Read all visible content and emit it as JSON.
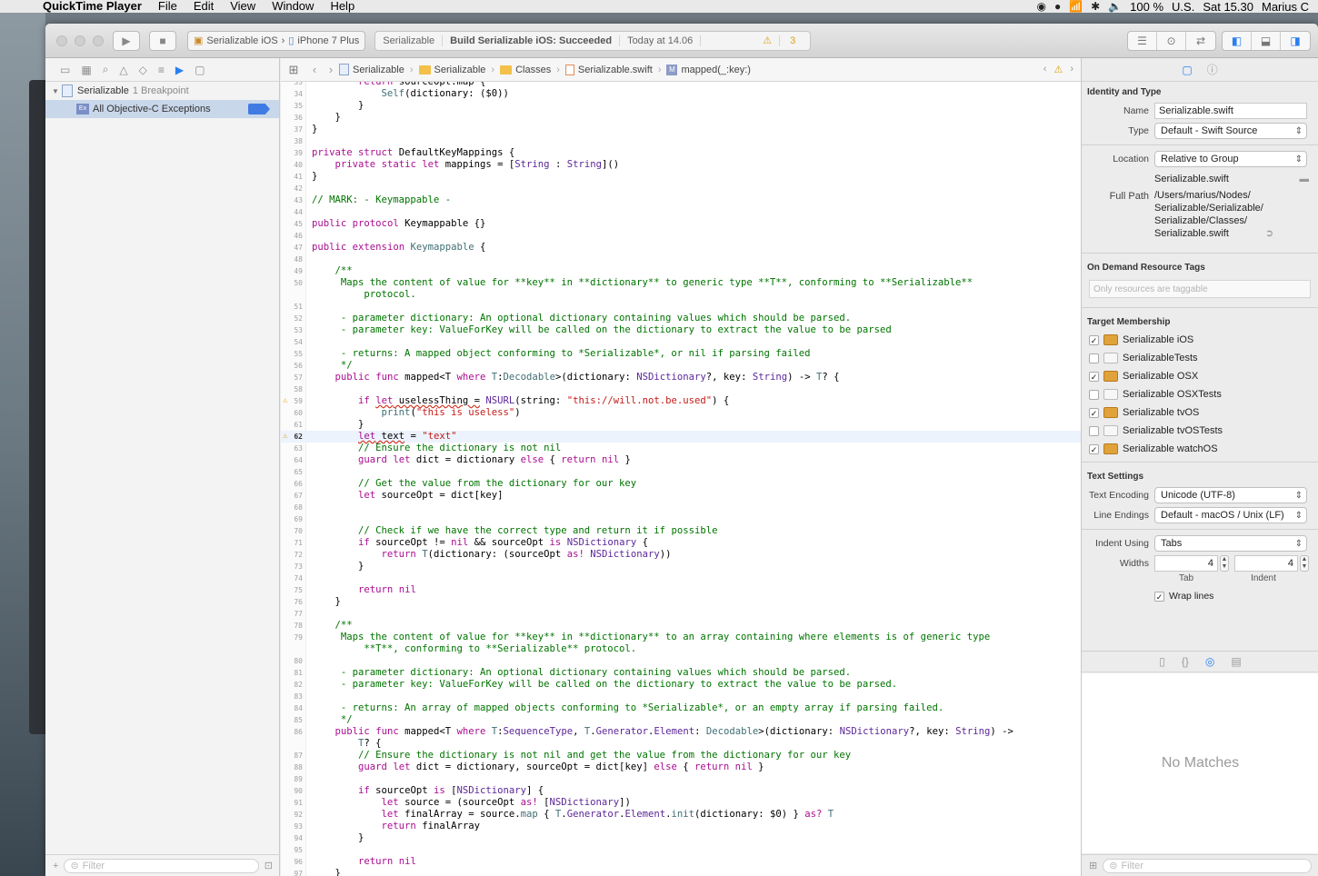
{
  "menubar": {
    "app": "QuickTime Player",
    "items": [
      "File",
      "Edit",
      "View",
      "Window",
      "Help"
    ],
    "battery": "100 %",
    "input_source": "U.S.",
    "clock": "Sat 15.30",
    "user": "Marius C"
  },
  "toolbar": {
    "scheme": "Serializable iOS",
    "device": "iPhone 7 Plus",
    "activity_project": "Serializable",
    "activity_status": "Build Serializable iOS: Succeeded",
    "activity_time": "Today at 14.06",
    "warning_count": "3"
  },
  "navigator": {
    "project": "Serializable",
    "project_sub": "1 Breakpoint",
    "breakpoint": "All Objective-C Exceptions",
    "breakpoint_icon": "Ex",
    "filter_placeholder": "Filter"
  },
  "jumpbar": [
    "Serializable",
    "Serializable",
    "Classes",
    "Serializable.swift",
    "mapped(_:key:)"
  ],
  "jumpbar_method_icon": "M",
  "code": {
    "current_line": 62,
    "warning_lines": [
      59,
      62
    ],
    "lines": [
      {
        "n": "33",
        "h": "        <span class=\"k\">return</span> sourceOpt.map {"
      },
      {
        "n": "34",
        "h": "            <span class=\"f\">Self</span>(dictionary: ($0))"
      },
      {
        "n": "35",
        "h": "        }"
      },
      {
        "n": "36",
        "h": "    }"
      },
      {
        "n": "37",
        "h": "}"
      },
      {
        "n": "38",
        "h": ""
      },
      {
        "n": "39",
        "h": "<span class=\"k\">private</span> <span class=\"k\">struct</span> DefaultKeyMappings {"
      },
      {
        "n": "40",
        "h": "    <span class=\"k\">private</span> <span class=\"k\">static</span> <span class=\"k\">let</span> mappings = [<span class=\"t\">String</span> : <span class=\"t\">String</span>]()"
      },
      {
        "n": "41",
        "h": "}"
      },
      {
        "n": "42",
        "h": ""
      },
      {
        "n": "43",
        "h": "<span class=\"c\">// MARK: - Keymappable -</span>"
      },
      {
        "n": "44",
        "h": ""
      },
      {
        "n": "45",
        "h": "<span class=\"k\">public</span> <span class=\"k\">protocol</span> Keymappable {}"
      },
      {
        "n": "46",
        "h": ""
      },
      {
        "n": "47",
        "h": "<span class=\"k\">public</span> <span class=\"k\">extension</span> <span class=\"f\">Keymappable</span> {"
      },
      {
        "n": "48",
        "h": ""
      },
      {
        "n": "49",
        "h": "    <span class=\"c\">/**</span>"
      },
      {
        "n": "50",
        "h": "<span class=\"c\">     Maps the content of value for **key** in **dictionary** to generic type **T**, conforming to **Serializable**</span>"
      },
      {
        "n": "",
        "h": "<span class=\"c\">         protocol.</span>"
      },
      {
        "n": "51",
        "h": ""
      },
      {
        "n": "52",
        "h": "<span class=\"c\">     - parameter dictionary: An optional dictionary containing values which should be parsed.</span>"
      },
      {
        "n": "53",
        "h": "<span class=\"c\">     - parameter key: ValueForKey will be called on the dictionary to extract the value to be parsed</span>"
      },
      {
        "n": "54",
        "h": ""
      },
      {
        "n": "55",
        "h": "<span class=\"c\">     - returns: A mapped object conforming to *Serializable*, or nil if parsing failed</span>"
      },
      {
        "n": "56",
        "h": "<span class=\"c\">     */</span>"
      },
      {
        "n": "57",
        "h": "    <span class=\"k\">public</span> <span class=\"k\">func</span> mapped&lt;T <span class=\"k\">where</span> <span class=\"f\">T</span>:<span class=\"f\">Decodable</span>&gt;(dictionary: <span class=\"t\">NSDictionary</span>?, key: <span class=\"t\">String</span>) -&gt; <span class=\"f\">T</span>? {"
      },
      {
        "n": "58",
        "h": ""
      },
      {
        "n": "59",
        "h": "        <span class=\"k\">if</span> <span class=\"u\"><span class=\"k\">let</span> uselessThing =</span> <span class=\"t\">NSURL</span>(string: <span class=\"s\">\"this://will.not.be.used\"</span>) {"
      },
      {
        "n": "60",
        "h": "            <span class=\"f\">print</span>(<span class=\"s\">\"this is useless\"</span>)"
      },
      {
        "n": "61",
        "h": "        }"
      },
      {
        "n": "62",
        "h": "        <span class=\"u\"><span class=\"k\">let</span> text</span> = <span class=\"s\">\"text\"</span>"
      },
      {
        "n": "63",
        "h": "        <span class=\"c\">// Ensure the dictionary is not nil</span>"
      },
      {
        "n": "64",
        "h": "        <span class=\"k\">guard</span> <span class=\"k\">let</span> dict = dictionary <span class=\"k\">else</span> { <span class=\"k\">return</span> <span class=\"k\">nil</span> }"
      },
      {
        "n": "65",
        "h": ""
      },
      {
        "n": "66",
        "h": "        <span class=\"c\">// Get the value from the dictionary for our key</span>"
      },
      {
        "n": "67",
        "h": "        <span class=\"k\">let</span> sourceOpt = dict[key]"
      },
      {
        "n": "68",
        "h": ""
      },
      {
        "n": "69",
        "h": ""
      },
      {
        "n": "70",
        "h": "        <span class=\"c\">// Check if we have the correct type and return it if possible</span>"
      },
      {
        "n": "71",
        "h": "        <span class=\"k\">if</span> sourceOpt != <span class=\"k\">nil</span> &amp;&amp; sourceOpt <span class=\"k\">is</span> <span class=\"t\">NSDictionary</span> {"
      },
      {
        "n": "72",
        "h": "            <span class=\"k\">return</span> <span class=\"f\">T</span>(dictionary: (sourceOpt <span class=\"k\">as!</span> <span class=\"t\">NSDictionary</span>))"
      },
      {
        "n": "73",
        "h": "        }"
      },
      {
        "n": "74",
        "h": ""
      },
      {
        "n": "75",
        "h": "        <span class=\"k\">return</span> <span class=\"k\">nil</span>"
      },
      {
        "n": "76",
        "h": "    }"
      },
      {
        "n": "77",
        "h": ""
      },
      {
        "n": "78",
        "h": "    <span class=\"c\">/**</span>"
      },
      {
        "n": "79",
        "h": "<span class=\"c\">     Maps the content of value for **key** in **dictionary** to an array containing where elements is of generic type</span>"
      },
      {
        "n": "",
        "h": "<span class=\"c\">         **T**, conforming to **Serializable** protocol.</span>"
      },
      {
        "n": "80",
        "h": ""
      },
      {
        "n": "81",
        "h": "<span class=\"c\">     - parameter dictionary: An optional dictionary containing values which should be parsed.</span>"
      },
      {
        "n": "82",
        "h": "<span class=\"c\">     - parameter key: ValueForKey will be called on the dictionary to extract the value to be parsed.</span>"
      },
      {
        "n": "83",
        "h": ""
      },
      {
        "n": "84",
        "h": "<span class=\"c\">     - returns: An array of mapped objects conforming to *Serializable*, or an empty array if parsing failed.</span>"
      },
      {
        "n": "85",
        "h": "<span class=\"c\">     */</span>"
      },
      {
        "n": "86",
        "h": "    <span class=\"k\">public</span> <span class=\"k\">func</span> mapped&lt;T <span class=\"k\">where</span> <span class=\"f\">T</span>:<span class=\"t\">SequenceType</span>, <span class=\"f\">T</span>.<span class=\"t\">Generator</span>.<span class=\"t\">Element</span>: <span class=\"f\">Decodable</span>&gt;(dictionary: <span class=\"t\">NSDictionary</span>?, key: <span class=\"t\">String</span>) -&gt;"
      },
      {
        "n": "",
        "h": "        <span class=\"f\">T</span>? {"
      },
      {
        "n": "87",
        "h": "        <span class=\"c\">// Ensure the dictionary is not nil and get the value from the dictionary for our key</span>"
      },
      {
        "n": "88",
        "h": "        <span class=\"k\">guard</span> <span class=\"k\">let</span> dict = dictionary, sourceOpt = dict[key] <span class=\"k\">else</span> { <span class=\"k\">return</span> <span class=\"k\">nil</span> }"
      },
      {
        "n": "89",
        "h": ""
      },
      {
        "n": "90",
        "h": "        <span class=\"k\">if</span> sourceOpt <span class=\"k\">is</span> [<span class=\"t\">NSDictionary</span>] {"
      },
      {
        "n": "91",
        "h": "            <span class=\"k\">let</span> source = (sourceOpt <span class=\"k\">as!</span> [<span class=\"t\">NSDictionary</span>])"
      },
      {
        "n": "92",
        "h": "            <span class=\"k\">let</span> finalArray = source.<span class=\"f\">map</span> { <span class=\"f\">T</span>.<span class=\"t\">Generator</span>.<span class=\"t\">Element</span>.<span class=\"f\">init</span>(dictionary: $0) } <span class=\"k\">as?</span> <span class=\"f\">T</span>"
      },
      {
        "n": "93",
        "h": "            <span class=\"k\">return</span> finalArray"
      },
      {
        "n": "94",
        "h": "        }"
      },
      {
        "n": "95",
        "h": ""
      },
      {
        "n": "96",
        "h": "        <span class=\"k\">return</span> <span class=\"k\">nil</span>"
      },
      {
        "n": "97",
        "h": "    }"
      }
    ]
  },
  "inspector": {
    "identity_title": "Identity and Type",
    "name_label": "Name",
    "name_value": "Serializable.swift",
    "type_label": "Type",
    "type_value": "Default - Swift Source",
    "location_label": "Location",
    "location_value": "Relative to Group",
    "location_file": "Serializable.swift",
    "fullpath_label": "Full Path",
    "fullpath_lines": [
      "/Users/marius/Nodes/",
      "Serializable/Serializable/",
      "Serializable/Classes/",
      "Serializable.swift"
    ],
    "odr_title": "On Demand Resource Tags",
    "odr_placeholder": "Only resources are taggable",
    "target_title": "Target Membership",
    "targets": [
      {
        "name": "Serializable iOS",
        "checked": true,
        "kind": "app"
      },
      {
        "name": "SerializableTests",
        "checked": false,
        "kind": "test"
      },
      {
        "name": "Serializable OSX",
        "checked": true,
        "kind": "app"
      },
      {
        "name": "Serializable OSXTests",
        "checked": false,
        "kind": "test"
      },
      {
        "name": "Serializable tvOS",
        "checked": true,
        "kind": "app"
      },
      {
        "name": "Serializable tvOSTests",
        "checked": false,
        "kind": "test"
      },
      {
        "name": "Serializable watchOS",
        "checked": true,
        "kind": "app"
      }
    ],
    "text_title": "Text Settings",
    "encoding_label": "Text Encoding",
    "encoding_value": "Unicode (UTF-8)",
    "endings_label": "Line Endings",
    "endings_value": "Default - macOS / Unix (LF)",
    "indent_label": "Indent Using",
    "indent_value": "Tabs",
    "widths_label": "Widths",
    "tab_value": "4",
    "indent_width_value": "4",
    "tab_label": "Tab",
    "indent_sub_label": "Indent",
    "wrap_label": "Wrap lines",
    "no_matches": "No Matches",
    "filter_placeholder": "Filter"
  },
  "colors": {
    "accent": "#2a7ff0",
    "warning": "#e0a10e",
    "keyword": "#aa0d91",
    "string": "#c41a16",
    "comment": "#007400"
  }
}
